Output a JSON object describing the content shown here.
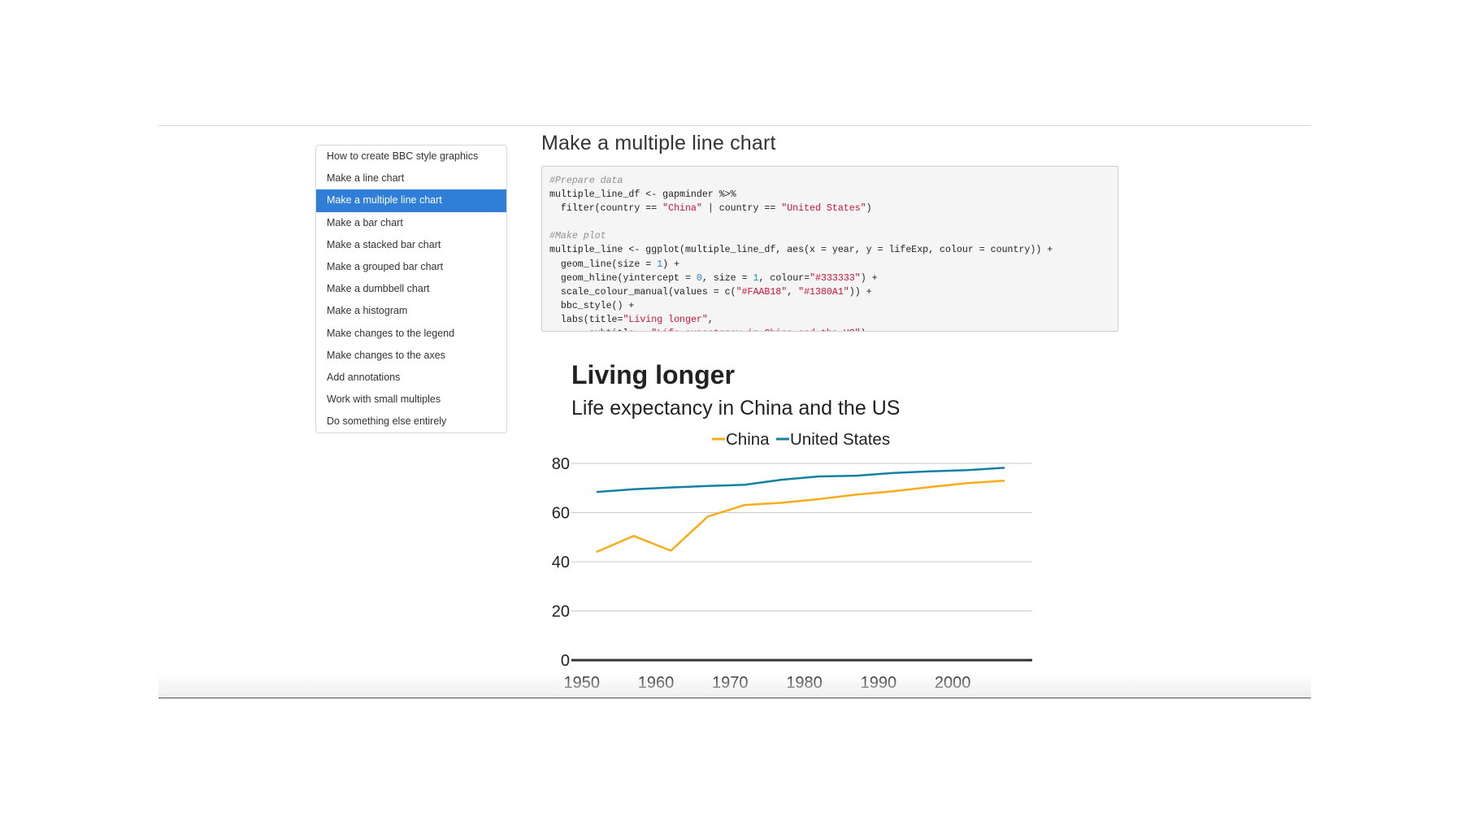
{
  "sidebar": {
    "items": [
      {
        "label": "How to create BBC style graphics",
        "active": false
      },
      {
        "label": "Make a line chart",
        "active": false
      },
      {
        "label": "Make a multiple line chart",
        "active": true
      },
      {
        "label": "Make a bar chart",
        "active": false
      },
      {
        "label": "Make a stacked bar chart",
        "active": false
      },
      {
        "label": "Make a grouped bar chart",
        "active": false
      },
      {
        "label": "Make a dumbbell chart",
        "active": false
      },
      {
        "label": "Make a histogram",
        "active": false
      },
      {
        "label": "Make changes to the legend",
        "active": false
      },
      {
        "label": "Make changes to the axes",
        "active": false
      },
      {
        "label": "Add annotations",
        "active": false
      },
      {
        "label": "Work with small multiples",
        "active": false
      },
      {
        "label": "Do something else entirely",
        "active": false
      }
    ],
    "active_color": "#2f7ed8"
  },
  "main": {
    "section_title": "Make a multiple line chart",
    "code_lines": [
      [
        {
          "t": "#Prepare data",
          "c": "cm"
        }
      ],
      [
        {
          "t": "multiple_line_df <- gapminder %>%",
          "c": ""
        }
      ],
      [
        {
          "t": "  filter(country == ",
          "c": ""
        },
        {
          "t": "\"China\"",
          "c": "st"
        },
        {
          "t": " | country == ",
          "c": ""
        },
        {
          "t": "\"United States\"",
          "c": "st"
        },
        {
          "t": ")",
          "c": ""
        }
      ],
      [
        {
          "t": "",
          "c": ""
        }
      ],
      [
        {
          "t": "#Make plot",
          "c": "cm"
        }
      ],
      [
        {
          "t": "multiple_line <- ggplot(multiple_line_df, aes(x = year, y = lifeExp, colour = country)) +",
          "c": ""
        }
      ],
      [
        {
          "t": "  geom_line(size = ",
          "c": ""
        },
        {
          "t": "1",
          "c": "nu"
        },
        {
          "t": ") +",
          "c": ""
        }
      ],
      [
        {
          "t": "  geom_hline(yintercept = ",
          "c": ""
        },
        {
          "t": "0",
          "c": "nu"
        },
        {
          "t": ", size = ",
          "c": ""
        },
        {
          "t": "1",
          "c": "nu"
        },
        {
          "t": ", colour=",
          "c": ""
        },
        {
          "t": "\"#333333\"",
          "c": "st"
        },
        {
          "t": ") +",
          "c": ""
        }
      ],
      [
        {
          "t": "  scale_colour_manual(values = c(",
          "c": ""
        },
        {
          "t": "\"#FAAB18\"",
          "c": "st"
        },
        {
          "t": ", ",
          "c": ""
        },
        {
          "t": "\"#1380A1\"",
          "c": "st"
        },
        {
          "t": ")) +",
          "c": ""
        }
      ],
      [
        {
          "t": "  bbc_style() +",
          "c": ""
        }
      ],
      [
        {
          "t": "  labs(title=",
          "c": ""
        },
        {
          "t": "\"Living longer\"",
          "c": "st"
        },
        {
          "t": ",",
          "c": ""
        }
      ],
      [
        {
          "t": "       subtitle = ",
          "c": ""
        },
        {
          "t": "\"Life expectancy in China and the US\"",
          "c": "st"
        },
        {
          "t": ")",
          "c": ""
        }
      ]
    ]
  },
  "chart_data": {
    "type": "line",
    "title": "Living longer",
    "subtitle": "Life expectancy in China and the US",
    "xlabel": "",
    "ylabel": "",
    "xlim": [
      1950,
      2007
    ],
    "ylim": [
      0,
      80
    ],
    "x_ticks": [
      1950,
      1960,
      1970,
      1980,
      1990,
      2000
    ],
    "y_ticks": [
      0,
      20,
      40,
      60,
      80
    ],
    "grid": true,
    "legend_position": "top",
    "x": [
      1952,
      1957,
      1962,
      1967,
      1972,
      1977,
      1982,
      1987,
      1992,
      1997,
      2002,
      2007
    ],
    "series": [
      {
        "name": "China",
        "color": "#FAAB18",
        "values": [
          44.0,
          50.5,
          44.5,
          58.4,
          63.1,
          64.0,
          65.5,
          67.3,
          68.7,
          70.4,
          72.0,
          73.0
        ]
      },
      {
        "name": "United States",
        "color": "#1380A1",
        "values": [
          68.4,
          69.5,
          70.2,
          70.8,
          71.3,
          73.4,
          74.7,
          75.0,
          76.1,
          76.8,
          77.3,
          78.2
        ]
      }
    ],
    "baseline_color": "#333333",
    "grid_color": "#cbcbcb"
  }
}
